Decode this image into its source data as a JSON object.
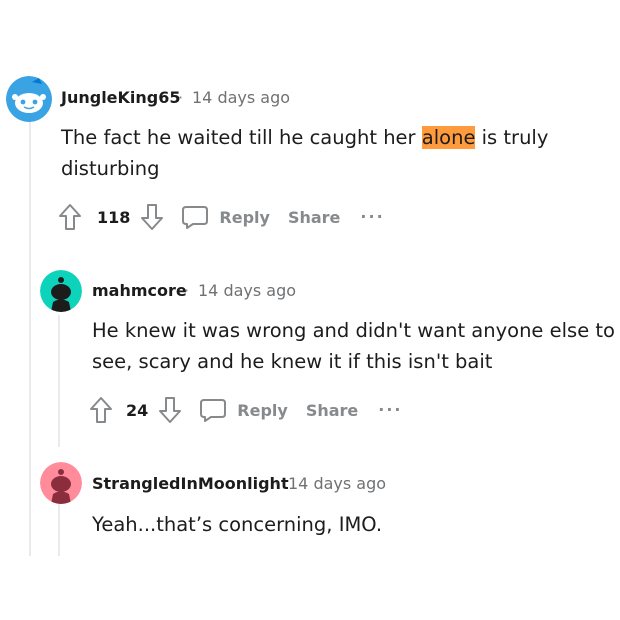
{
  "comments": [
    {
      "username": "JungleKing65",
      "separator": "·",
      "time": "14 days ago",
      "text_before": "The fact he waited till he caught her ",
      "text_highlight": "alone",
      "text_after": " is truly disturbing",
      "votes": "118",
      "reply_label": "Reply",
      "share_label": "Share",
      "more_label": "...",
      "avatar_color": "#3aa3e3"
    },
    {
      "username": "mahmcore",
      "separator": "·",
      "time": "14 days ago",
      "text": "He knew it was wrong and didn't want anyone else to see, scary and he knew it if this isn't bait",
      "votes": "24",
      "reply_label": "Reply",
      "share_label": "Share",
      "more_label": "...",
      "avatar_color": "#0dd3bb"
    },
    {
      "username": "StrangledInMoonlight",
      "separator": "·",
      "time": "14 days ago",
      "text": "Yeah...that’s concerning, IMO.",
      "avatar_color": "#ff8b9b"
    }
  ],
  "colors": {
    "highlight": "#ff9b3d",
    "thread_line": "#e9eaeb",
    "muted": "#878a8c"
  }
}
